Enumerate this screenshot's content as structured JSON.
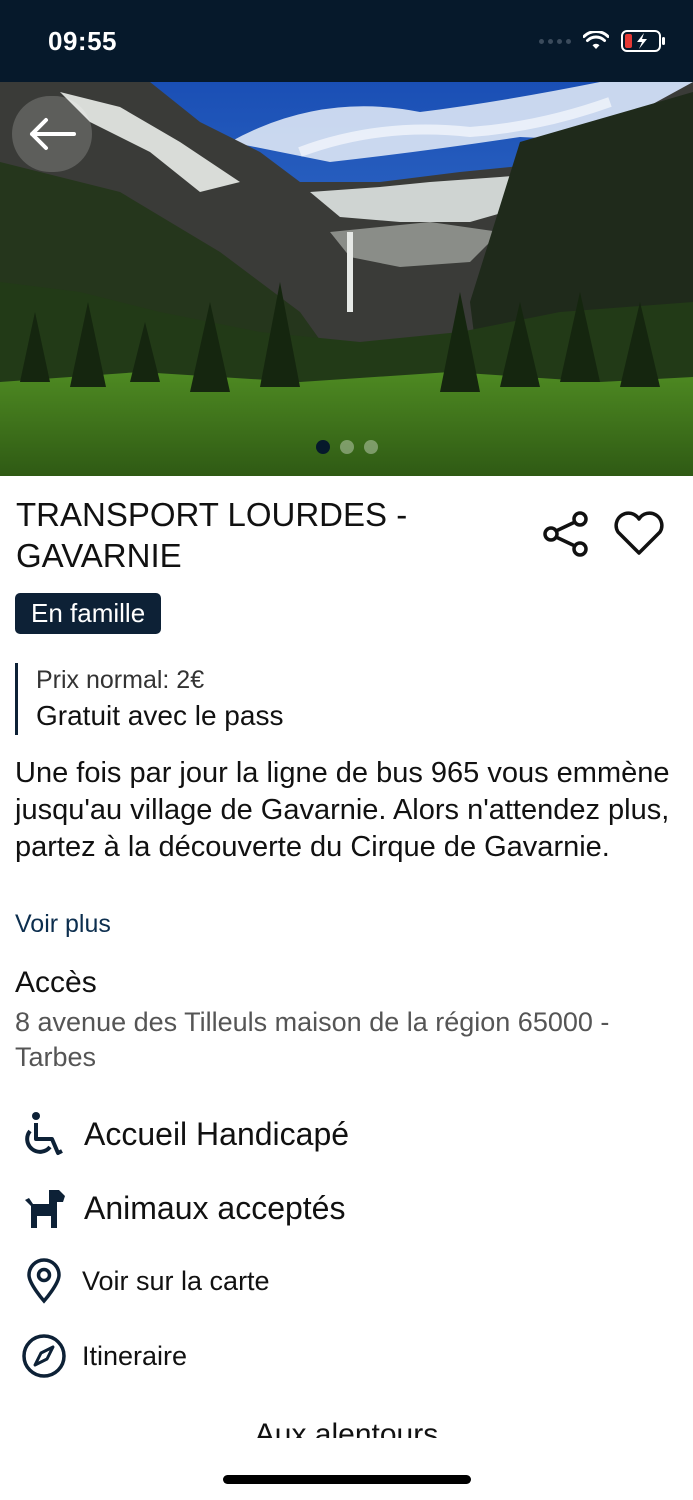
{
  "status": {
    "time": "09:55"
  },
  "hero": {
    "slides": 3,
    "active_slide": 1,
    "image_description": "mountain cirque with waterfall and green meadow"
  },
  "title": "TRANSPORT LOURDES - GAVARNIE",
  "badge": "En famille",
  "price": {
    "normal": "Prix normal: 2€",
    "pass": "Gratuit avec le pass"
  },
  "description": "Une fois par jour la ligne de bus 965 vous emmène jusqu'au village de Gavarnie. Alors n'attendez plus, partez à la découverte du Cirque de Gavarnie.",
  "see_more": "Voir plus",
  "access": {
    "title": "Accès",
    "address": "8 avenue des Tilleuls maison de la région 65000 - Tarbes"
  },
  "features": [
    {
      "label": "Accueil Handicapé",
      "icon": "wheelchair-icon"
    },
    {
      "label": "Animaux acceptés",
      "icon": "dog-icon"
    }
  ],
  "actions": [
    {
      "label": "Voir sur la carte",
      "icon": "map-pin-icon"
    },
    {
      "label": "Itineraire",
      "icon": "compass-icon"
    }
  ],
  "around": "Aux alentours",
  "colors": {
    "status_bg": "#06192b",
    "accent": "#0d2136",
    "link": "#0c2e4e"
  }
}
